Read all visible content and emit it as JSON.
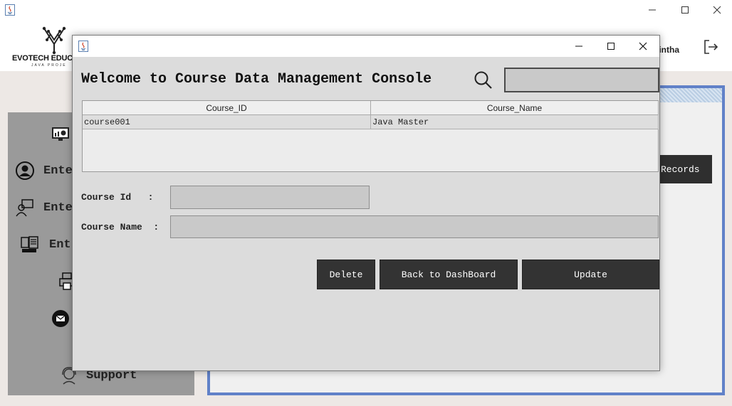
{
  "app": {
    "header": {
      "logo_title": "EVOTECH EDUC",
      "logo_subtitle": "JAVA PROJE",
      "user_name": "hintha"
    },
    "sidebar": {
      "items": [
        {
          "label": "",
          "icon": "dashboard-icon"
        },
        {
          "label": "Ente",
          "icon": "user-icon"
        },
        {
          "label": "Ente",
          "icon": "teacher-icon"
        },
        {
          "label": "Ent",
          "icon": "course-icon"
        },
        {
          "label": "",
          "icon": "printer-icon"
        },
        {
          "label": "",
          "icon": "mail-icon"
        },
        {
          "label": "Support",
          "icon": "support-icon"
        }
      ]
    },
    "main": {
      "records_button": "Records"
    }
  },
  "dialog": {
    "heading": "Welcome to Course Data Management Console",
    "search": {
      "value": "",
      "placeholder": ""
    },
    "table": {
      "columns": [
        "Course_ID",
        "Course_Name"
      ],
      "rows": [
        [
          "course001",
          "Java Master"
        ]
      ]
    },
    "form": {
      "course_id": {
        "label": "Course Id   :",
        "value": ""
      },
      "course_name": {
        "label": "Course Name  :",
        "value": ""
      }
    },
    "buttons": {
      "delete": "Delete",
      "back": "Back to DashBoard",
      "update": "Update"
    }
  },
  "colors": {
    "panel_border": "#6181c8",
    "button_dark": "#333333",
    "input_bg": "#c9c9c9",
    "sidebar_bg": "#9a9a9a"
  }
}
